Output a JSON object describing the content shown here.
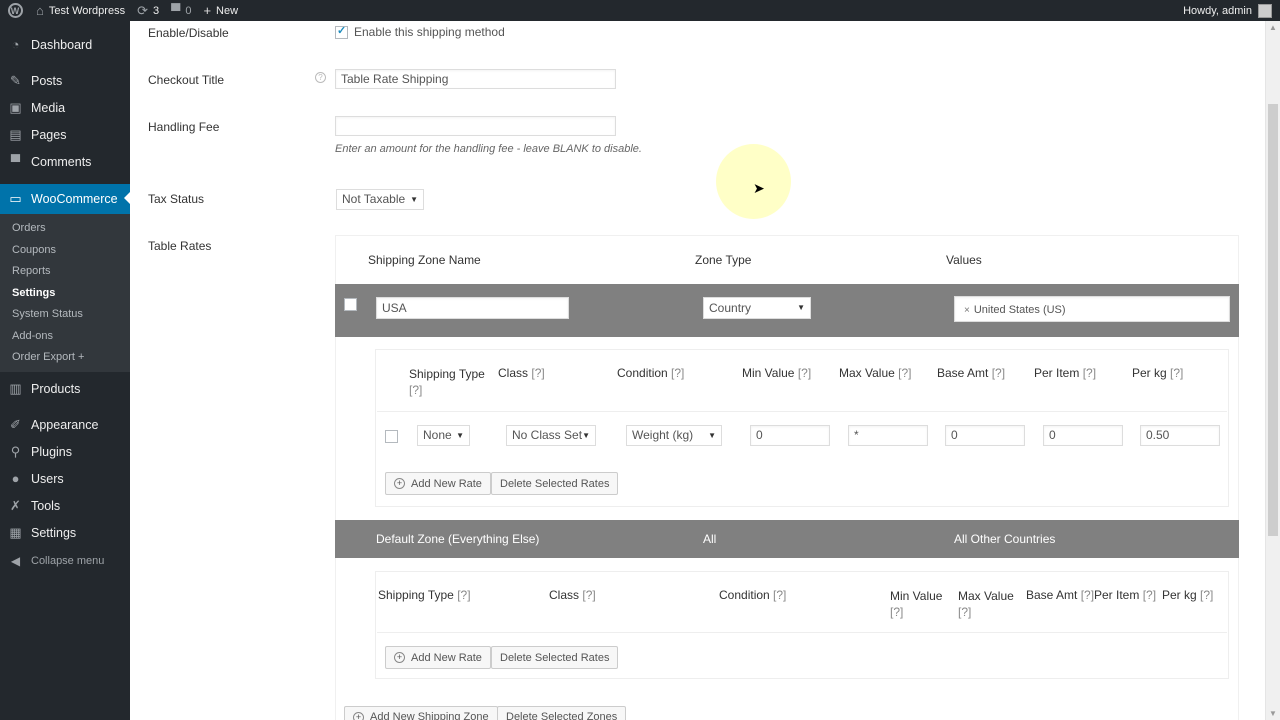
{
  "adminbar": {
    "site_name": "Test Wordpress",
    "updates_count": "3",
    "comments_count": "0",
    "new_label": "New",
    "howdy": "Howdy, admin"
  },
  "sidebar": {
    "dashboard": "Dashboard",
    "posts": "Posts",
    "media": "Media",
    "pages": "Pages",
    "comments": "Comments",
    "woocommerce": "WooCommerce",
    "woo_submenu": [
      "Orders",
      "Coupons",
      "Reports",
      "Settings",
      "System Status",
      "Add-ons",
      "Order Export +"
    ],
    "products": "Products",
    "appearance": "Appearance",
    "plugins": "Plugins",
    "users": "Users",
    "tools": "Tools",
    "settings": "Settings",
    "collapse": "Collapse menu"
  },
  "form": {
    "enable_label": "Enable/Disable",
    "enable_checkbox_label": "Enable this shipping method",
    "checkout_title_label": "Checkout Title",
    "checkout_title_value": "Table Rate Shipping",
    "handling_fee_label": "Handling Fee",
    "handling_fee_value": "",
    "handling_fee_desc": "Enter an amount for the handling fee - leave BLANK to disable.",
    "tax_status_label": "Tax Status",
    "tax_status_value": "Not Taxable",
    "table_rates_label": "Table Rates"
  },
  "zones_header": {
    "name": "Shipping Zone Name",
    "type": "Zone Type",
    "values": "Values"
  },
  "zone_usa": {
    "name_value": "USA",
    "type_value": "Country",
    "tag_value": "United States (US)"
  },
  "rates_header": {
    "shipping_type": "Shipping Type",
    "class": "Class",
    "condition": "Condition",
    "min_value": "Min Value",
    "max_value": "Max Value",
    "base_amt": "Base Amt",
    "per_item": "Per Item",
    "per_kg": "Per kg",
    "help": "[?]"
  },
  "rate_row": {
    "shipping_type": "None",
    "class": "No Class Set",
    "condition": "Weight (kg)",
    "min_value": "0",
    "max_value": "*",
    "base_amt": "0",
    "per_item": "0",
    "per_kg": "0.50"
  },
  "buttons": {
    "add_new_rate": "Add New Rate",
    "delete_selected_rates": "Delete Selected Rates",
    "add_new_zone": "Add New Shipping Zone",
    "delete_selected_zones": "Delete Selected Zones"
  },
  "default_zone": {
    "name": "Default Zone (Everything Else)",
    "type": "All",
    "values": "All Other Countries"
  },
  "rates_header2": {
    "shipping_type": "Shipping Type",
    "class": "Class",
    "condition": "Condition",
    "min_value": "Min Value",
    "max_value": "Max Value",
    "base_amt": "Base Amt",
    "per_item": "Per Item",
    "per_kg": "Per kg",
    "help": "[?]"
  },
  "colors": {
    "adminbar_bg": "#23282d",
    "accent": "#0073aa",
    "zone_row_bg": "#808080"
  }
}
